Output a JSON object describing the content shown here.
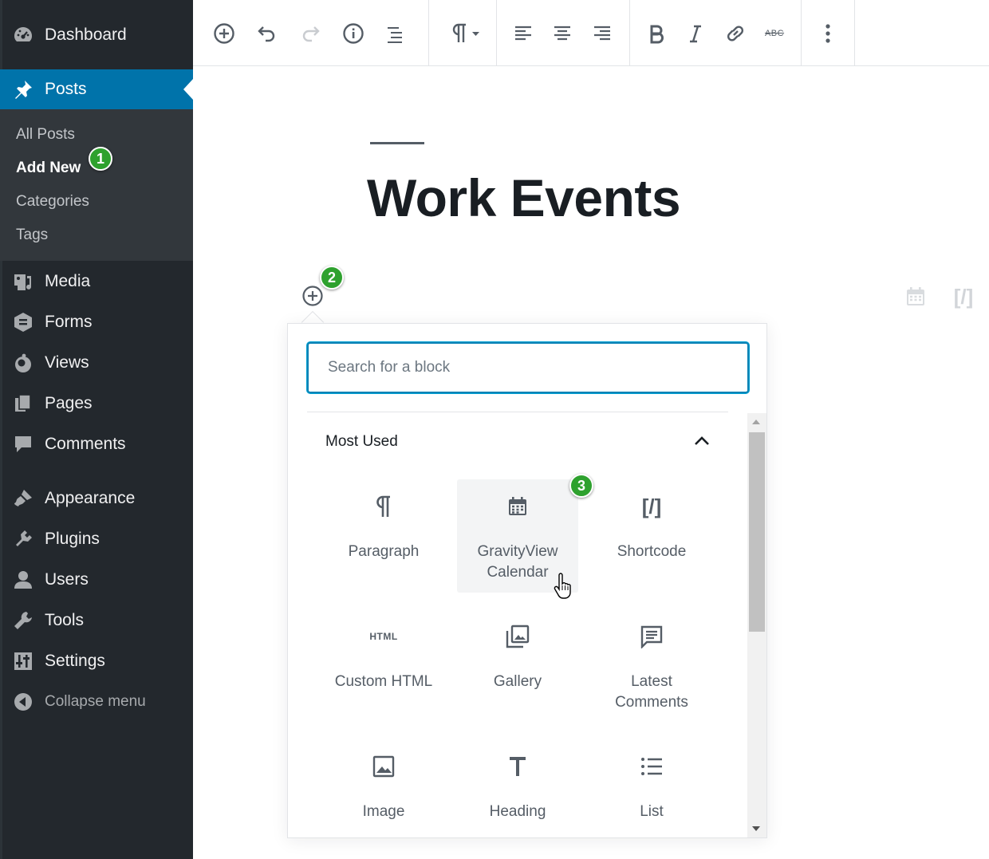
{
  "sidebar": {
    "items": [
      {
        "label": "Dashboard",
        "icon": "dashboard-icon"
      },
      {
        "label": "Posts",
        "icon": "pushpin-icon",
        "active": true
      },
      {
        "label": "Media",
        "icon": "media-icon"
      },
      {
        "label": "Forms",
        "icon": "forms-icon"
      },
      {
        "label": "Views",
        "icon": "views-icon"
      },
      {
        "label": "Pages",
        "icon": "pages-icon"
      },
      {
        "label": "Comments",
        "icon": "comment-icon"
      },
      {
        "label": "Appearance",
        "icon": "paintbrush-icon"
      },
      {
        "label": "Plugins",
        "icon": "plugin-icon"
      },
      {
        "label": "Users",
        "icon": "user-icon"
      },
      {
        "label": "Tools",
        "icon": "wrench-icon"
      },
      {
        "label": "Settings",
        "icon": "settings-icon"
      }
    ],
    "submenu": [
      "All Posts",
      "Add New",
      "Categories",
      "Tags"
    ],
    "collapse_label": "Collapse menu"
  },
  "badges": {
    "one": "1",
    "two": "2",
    "three": "3"
  },
  "toolbar": {
    "buttons": [
      "add-block",
      "undo",
      "redo",
      "info",
      "outline",
      "paragraph-style",
      "align-left",
      "align-center",
      "align-right",
      "bold",
      "italic",
      "link",
      "strikethrough",
      "more"
    ],
    "strikethrough_label": "ABC"
  },
  "editor": {
    "title": "Work Events"
  },
  "inserter": {
    "search_placeholder": "Search for a block",
    "panel_title": "Most Used",
    "blocks": [
      {
        "label": "Paragraph",
        "icon": "paragraph-icon"
      },
      {
        "label": "GravityView\nCalendar",
        "icon": "calendar-icon"
      },
      {
        "label": "Shortcode",
        "icon": "shortcode-icon"
      },
      {
        "label": "Custom HTML",
        "icon": "html-icon"
      },
      {
        "label": "Gallery",
        "icon": "gallery-icon"
      },
      {
        "label": "Latest\nComments",
        "icon": "comments-list-icon"
      },
      {
        "label": "Image",
        "icon": "image-icon"
      },
      {
        "label": "Heading",
        "icon": "heading-icon"
      },
      {
        "label": "List",
        "icon": "list-icon"
      }
    ],
    "html_icon_text": "HTML",
    "shortcode_icon_text": "[/]"
  },
  "colors": {
    "sidebar_bg": "#23282d",
    "active_bg": "#0073aa",
    "badge": "#2ea12e",
    "focus": "#0b83b5"
  }
}
